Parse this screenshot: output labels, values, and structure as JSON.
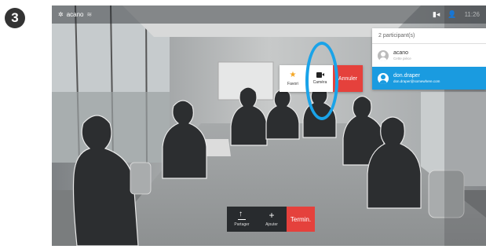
{
  "step_badge": "3",
  "topbar": {
    "system_name": "acano",
    "wifi_icon": "wifi-icon",
    "camera_icon": "camera-self-view-icon",
    "participants_icon": "participants-icon",
    "time": "11:26"
  },
  "participants_panel": {
    "header": "2 participant(s)",
    "items": [
      {
        "name": "acano",
        "detail": "Cette pièce",
        "selected": false
      },
      {
        "name": "don.draper",
        "detail": "don.draper@somewhere.com",
        "selected": true
      }
    ]
  },
  "popup": {
    "favorite_label": "Favori",
    "camera_label": "Caméra",
    "cancel_label": "Annuler"
  },
  "bottombar": {
    "share_label": "Partager",
    "add_label": "Ajouter",
    "end_label": "Termin."
  },
  "colors": {
    "accent_blue": "#1a9be0",
    "danger_red": "#e5413c",
    "star": "#f4a623"
  }
}
